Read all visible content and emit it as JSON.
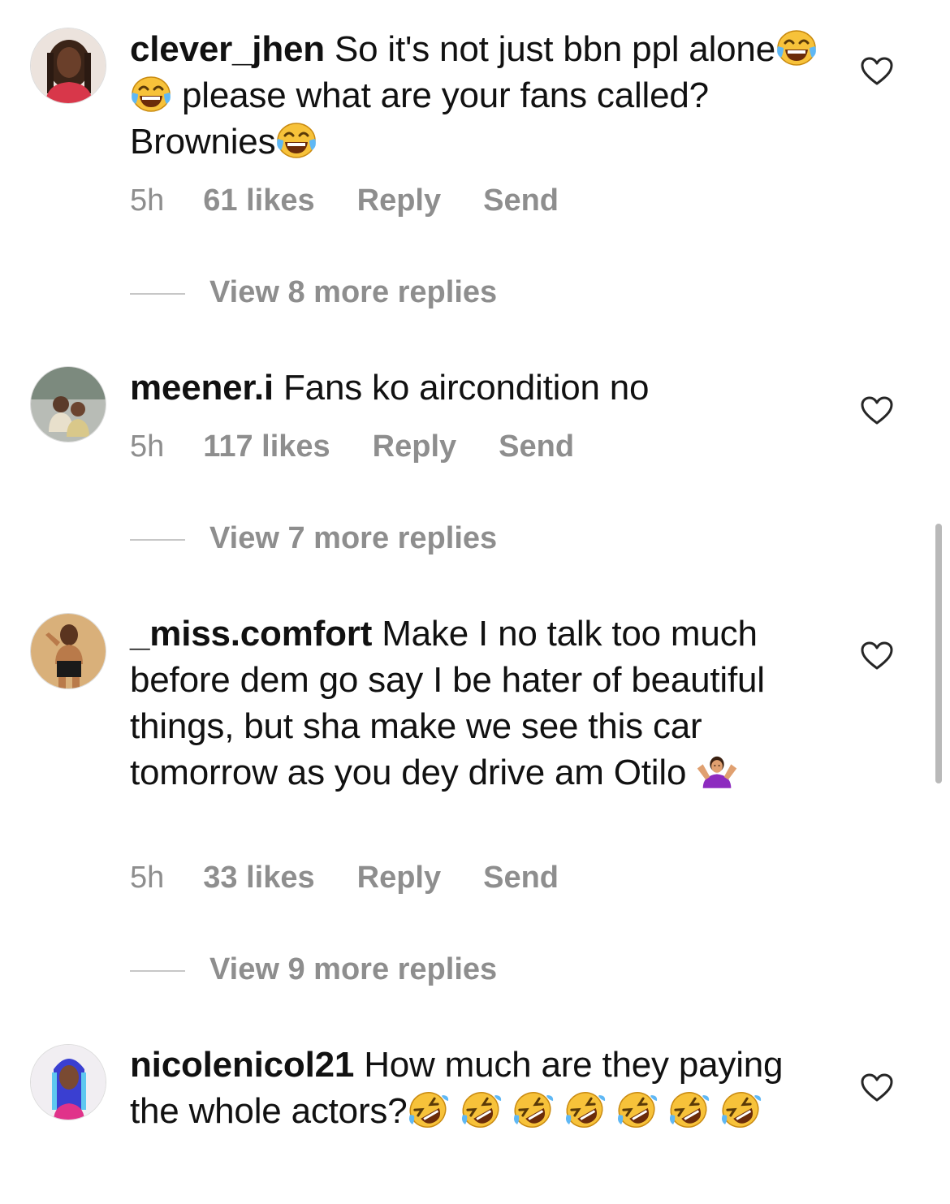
{
  "comments": [
    {
      "username": "clever_jhen",
      "text_1": " So it's not just bbn ppl alone",
      "text_2": "please what are your fans called? Brownies",
      "time": "5h",
      "likes": "61 likes",
      "reply": "Reply",
      "send": "Send",
      "view_replies": "View 8 more replies"
    },
    {
      "username": "meener.i",
      "text_1": " Fans ko aircondition no",
      "time": "5h",
      "likes": "117 likes",
      "reply": "Reply",
      "send": "Send",
      "view_replies": "View 7 more replies"
    },
    {
      "username": "_miss.comfort",
      "text_1": " Make I no talk too much before dem go say I be hater of beautiful things, but sha make we see this car tomorrow as you dey drive am Otilo ",
      "time": "5h",
      "likes": "33 likes",
      "reply": "Reply",
      "send": "Send",
      "view_replies": "View 9 more replies"
    },
    {
      "username": "nicolenicol21",
      "text_1": " How much are they paying the whole actors?"
    }
  ],
  "icons": {
    "like": "heart-outline-icon",
    "laugh": "face-with-tears-of-joy",
    "rofl": "rolling-on-floor-laughing",
    "shrug": "woman-shrugging"
  },
  "colors": {
    "text": "#111111",
    "muted": "#8e8e8e",
    "line": "#c7c7c7",
    "emoji_yellow": "#f7c23a",
    "emoji_purple": "#8d2bbf"
  }
}
